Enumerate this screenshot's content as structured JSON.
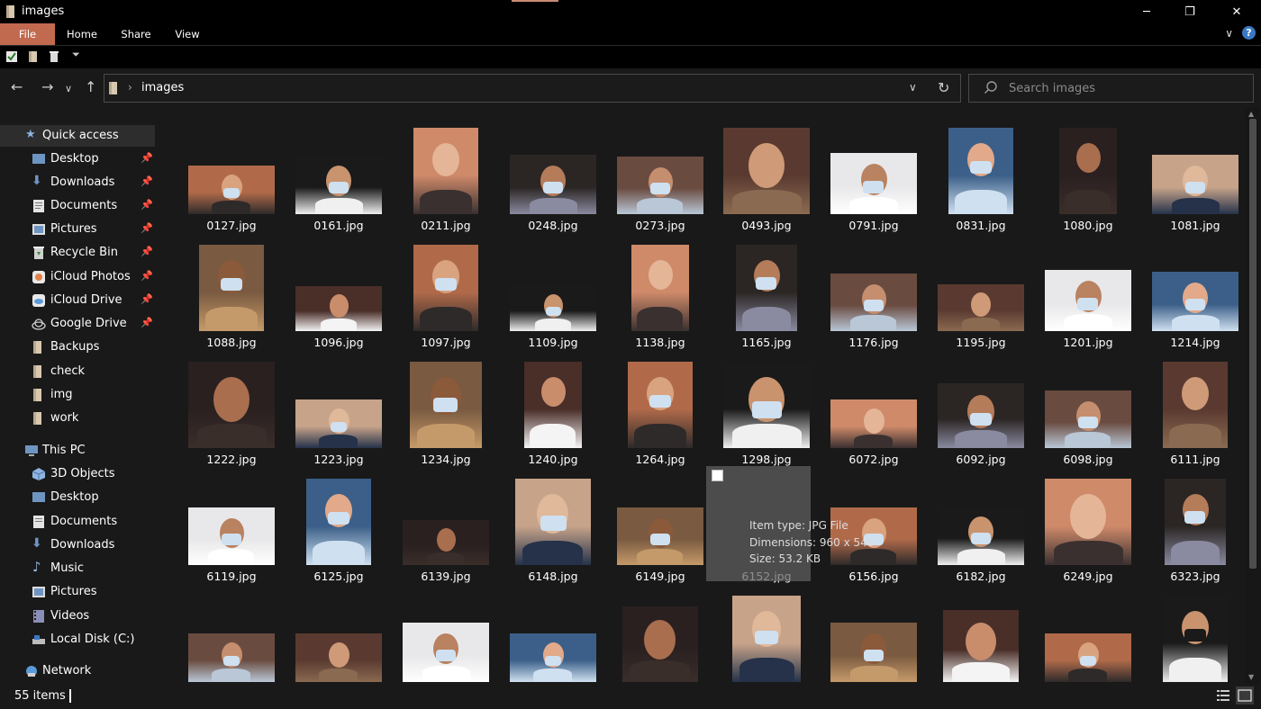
{
  "window": {
    "title": "images",
    "minimize": "─",
    "maximize": "❐",
    "close": "✕"
  },
  "ribbon": {
    "tabs": [
      "File",
      "Home",
      "Share",
      "View"
    ],
    "help": "?",
    "expand": "∨"
  },
  "address": {
    "breadcrumb": "images",
    "dropdown": "∨",
    "refresh": "↻"
  },
  "search": {
    "placeholder": "Search images"
  },
  "nav": {
    "quick_access": "Quick access",
    "quick_items": [
      "Desktop",
      "Downloads",
      "Documents",
      "Pictures",
      "Recycle Bin",
      "iCloud Photos",
      "iCloud Drive",
      "Google Drive",
      "Backups",
      "check",
      "img",
      "work"
    ],
    "this_pc": "This PC",
    "pc_items": [
      "3D Objects",
      "Desktop",
      "Documents",
      "Downloads",
      "Music",
      "Pictures",
      "Videos",
      "Local Disk (C:)"
    ],
    "network": "Network"
  },
  "files": [
    "0127.jpg",
    "0161.jpg",
    "0211.jpg",
    "0248.jpg",
    "0273.jpg",
    "0493.jpg",
    "0791.jpg",
    "0831.jpg",
    "1080.jpg",
    "1081.jpg",
    "1088.jpg",
    "1096.jpg",
    "1097.jpg",
    "1109.jpg",
    "1138.jpg",
    "1165.jpg",
    "1176.jpg",
    "1195.jpg",
    "1201.jpg",
    "1214.jpg",
    "1222.jpg",
    "1223.jpg",
    "1234.jpg",
    "1240.jpg",
    "1264.jpg",
    "1298.jpg",
    "6072.jpg",
    "6092.jpg",
    "6098.jpg",
    "6111.jpg",
    "6119.jpg",
    "6125.jpg",
    "6139.jpg",
    "6148.jpg",
    "6149.jpg",
    "6152.jpg",
    "6156.jpg",
    "6182.jpg",
    "6249.jpg",
    "6323.jpg"
  ],
  "tooltip": {
    "type": "Item type: JPG File",
    "dimensions": "Dimensions: 960 x 540",
    "size": "Size: 53.2 KB"
  },
  "status": {
    "count": "55 items"
  }
}
